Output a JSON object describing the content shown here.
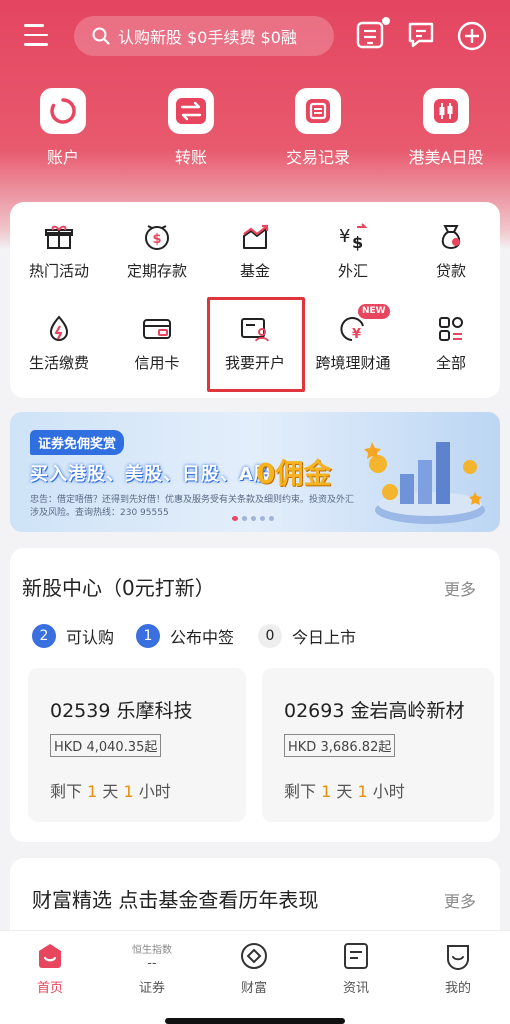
{
  "search": {
    "text": "认购新股 $0手续费 $0融"
  },
  "quick_actions": [
    {
      "label": "账户",
      "icon": "account-ring-icon"
    },
    {
      "label": "转账",
      "icon": "transfer-arrows-icon"
    },
    {
      "label": "交易记录",
      "icon": "record-list-icon"
    },
    {
      "label": "港美A日股",
      "icon": "candlestick-icon"
    }
  ],
  "services": [
    {
      "label": "热门活动",
      "icon": "gift-icon"
    },
    {
      "label": "定期存款",
      "icon": "deposit-clock-icon"
    },
    {
      "label": "基金",
      "icon": "fund-chart-icon"
    },
    {
      "label": "外汇",
      "icon": "forex-icon"
    },
    {
      "label": "贷款",
      "icon": "loan-bag-icon"
    },
    {
      "label": "生活缴费",
      "icon": "utility-bill-icon"
    },
    {
      "label": "信用卡",
      "icon": "credit-card-icon"
    },
    {
      "label": "我要开户",
      "icon": "open-account-icon"
    },
    {
      "label": "跨境理财通",
      "icon": "cross-border-wealth-icon"
    },
    {
      "label": "全部",
      "icon": "all-grid-icon"
    }
  ],
  "new_badge": "NEW",
  "banner": {
    "tag": "证券免佣奖赏",
    "headline": "买入港股、美股、日股、A股",
    "big": "0佣金",
    "fine_print": "忠告：借定唔借？还得到先好借！优惠及服务受有关条款及细则约束。投资及外汇涉及风险。查询热线：230 95555"
  },
  "ipo": {
    "title": "新股中心（0元打新）",
    "more": "更多",
    "stats": [
      {
        "count": "2",
        "label": "可认购"
      },
      {
        "count": "1",
        "label": "公布中签"
      },
      {
        "count": "0",
        "label": "今日上市"
      }
    ],
    "cards": [
      {
        "name": "02539 乐摩科技",
        "price": "HKD 4,040.35起",
        "remain_prefix": "剩下",
        "days": "1",
        "day_unit": "天",
        "hours": "1",
        "hour_unit": "小时"
      },
      {
        "name": "02693 金岩高岭新材",
        "price": "HKD 3,686.82起",
        "remain_prefix": "剩下",
        "days": "1",
        "day_unit": "天",
        "hours": "1",
        "hour_unit": "小时"
      }
    ]
  },
  "wealth": {
    "title": "财富精选 点击基金查看历年表现",
    "more": "更多"
  },
  "tabbar": {
    "tabs": [
      {
        "label": "首页",
        "active": true
      },
      {
        "label": "证券",
        "top": "恒生指数",
        "sub": "--"
      },
      {
        "label": "财富"
      },
      {
        "label": "资讯"
      },
      {
        "label": "我的"
      }
    ]
  },
  "colors": {
    "brand": "#e8455e",
    "accent_orange": "#e8900c",
    "stat_blue": "#3a6fe0"
  }
}
